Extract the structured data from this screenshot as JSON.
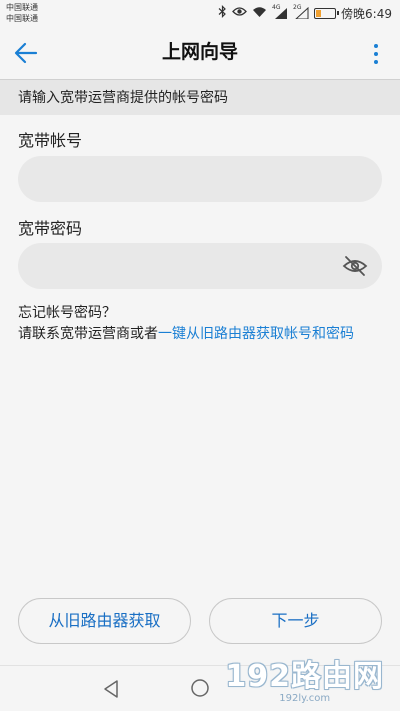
{
  "status_bar": {
    "carrier_1": "中国联通",
    "carrier_2": "中国联通",
    "network_1": "4G",
    "network_2": "2G",
    "time": "傍晚6:49",
    "battery_level": 0.25,
    "icons": [
      "bluetooth-icon",
      "eye-icon",
      "wifi-icon",
      "signal-icon",
      "signal-icon",
      "battery-icon"
    ]
  },
  "header": {
    "title": "上网向导",
    "back_icon": "arrow-left-icon",
    "more_icon": "more-vertical-icon",
    "accent_color": "#1a7fd4"
  },
  "banner": {
    "text": "请输入宽带运营商提供的帐号密码"
  },
  "form": {
    "account_label": "宽带帐号",
    "account_value": "",
    "password_label": "宽带密码",
    "password_value": "",
    "password_toggle_icon": "eye-off-icon"
  },
  "help": {
    "line1": "忘记帐号密码？",
    "line2_prefix": "请联系宽带运营商或者",
    "line2_link": "一键从旧路由器获取帐号和密码"
  },
  "buttons": {
    "get_from_old": "从旧路由器获取",
    "next": "下一步"
  },
  "watermark": {
    "main": "192路由网",
    "sub": "192ly.com"
  }
}
